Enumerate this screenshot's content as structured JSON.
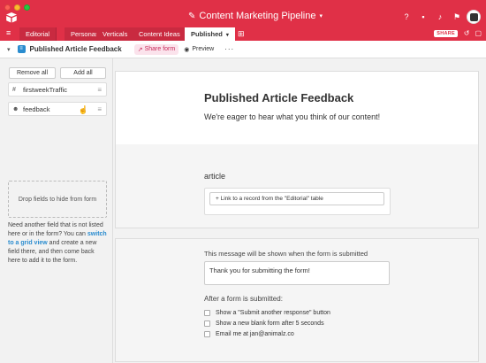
{
  "app": {
    "title": "Content Marketing Pipeline",
    "accent_color": "#e03047"
  },
  "tabs": [
    {
      "label": "Editorial"
    },
    {
      "label": "Personas"
    },
    {
      "label": "Verticals"
    },
    {
      "label": "Content Ideas"
    },
    {
      "label": "Published",
      "active": true
    }
  ],
  "header": {
    "share_label": "SHARE",
    "icons": [
      "help-icon",
      "bell-icon",
      "bell-icon",
      "avatar"
    ]
  },
  "viewbar": {
    "view_name": "Published Article Feedback",
    "share_form_label": "Share form",
    "preview_label": "Preview",
    "more_label": "···"
  },
  "sidebar": {
    "remove_all": "Remove all",
    "add_all": "Add all",
    "fields": [
      {
        "label": "firstweekTraffic",
        "icon": "hash-icon"
      },
      {
        "label": "feedback",
        "icon": "people-icon"
      }
    ],
    "dropzone": "Drop fields to hide from form",
    "help_pre": "Need another field that is not listed here or in the form? You can ",
    "help_link": "switch to a grid view",
    "help_post": " and create a new field there, and then come back here to add it to the form."
  },
  "form": {
    "title": "Published Article Feedback",
    "description": "We're eager to hear what you think of our content!",
    "field_label": "article",
    "link_button": "+ Link to a record from the \"Editorial\" table"
  },
  "submit": {
    "message_label": "This message will be shown when the form is submitted",
    "message_value": "Thank you for submitting the form!",
    "after_label": "After a form is submitted:",
    "options": [
      {
        "label": "Show a \"Submit another response\" button",
        "checked": false
      },
      {
        "label": "Show a new blank form after 5 seconds",
        "checked": false
      },
      {
        "label": "Email me at jan@animalz.co",
        "checked": false
      }
    ]
  }
}
